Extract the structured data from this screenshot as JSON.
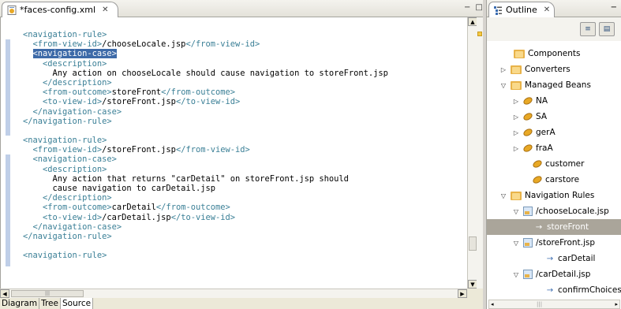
{
  "editor": {
    "tab_label": "*faces-config.xml",
    "tab_close": "✕",
    "view_min": "−",
    "view_max": "□",
    "code_lines": [
      {
        "parts": [
          [
            "tag",
            "<navigation-rule>"
          ]
        ]
      },
      {
        "parts": [
          [
            "tag",
            "  <from-view-id>"
          ],
          [
            "txt",
            "/chooseLocale.jsp"
          ],
          [
            "tag",
            "</from-view-id>"
          ]
        ]
      },
      {
        "parts": [
          [
            "tag",
            "  "
          ],
          [
            "sel",
            "<navigation-case>"
          ]
        ]
      },
      {
        "parts": [
          [
            "tag",
            "    <description>"
          ]
        ]
      },
      {
        "parts": [
          [
            "txt",
            "      Any action on chooseLocale should cause navigation to storeFront.jsp"
          ]
        ]
      },
      {
        "parts": [
          [
            "tag",
            "    </description>"
          ]
        ]
      },
      {
        "parts": [
          [
            "tag",
            "    <from-outcome>"
          ],
          [
            "txt",
            "storeFront"
          ],
          [
            "tag",
            "</from-outcome>"
          ]
        ]
      },
      {
        "parts": [
          [
            "tag",
            "    <to-view-id>"
          ],
          [
            "txt",
            "/storeFront.jsp"
          ],
          [
            "tag",
            "</to-view-id>"
          ]
        ]
      },
      {
        "parts": [
          [
            "tag",
            "  </navigation-case>"
          ]
        ]
      },
      {
        "parts": [
          [
            "tag",
            "</navigation-rule>"
          ]
        ]
      },
      {
        "parts": [
          [
            "txt",
            ""
          ]
        ]
      },
      {
        "parts": [
          [
            "tag",
            "<navigation-rule>"
          ]
        ]
      },
      {
        "parts": [
          [
            "tag",
            "  <from-view-id>"
          ],
          [
            "txt",
            "/storeFront.jsp"
          ],
          [
            "tag",
            "</from-view-id>"
          ]
        ]
      },
      {
        "parts": [
          [
            "tag",
            "  <navigation-case>"
          ]
        ]
      },
      {
        "parts": [
          [
            "tag",
            "    <description>"
          ]
        ]
      },
      {
        "parts": [
          [
            "txt",
            "      Any action that returns \"carDetail\" on storeFront.jsp should"
          ]
        ]
      },
      {
        "parts": [
          [
            "txt",
            "      cause navigation to carDetail.jsp"
          ]
        ]
      },
      {
        "parts": [
          [
            "tag",
            "    </description>"
          ]
        ]
      },
      {
        "parts": [
          [
            "tag",
            "    <from-outcome>"
          ],
          [
            "txt",
            "carDetail"
          ],
          [
            "tag",
            "</from-outcome>"
          ]
        ]
      },
      {
        "parts": [
          [
            "tag",
            "    <to-view-id>"
          ],
          [
            "txt",
            "/carDetail.jsp"
          ],
          [
            "tag",
            "</to-view-id>"
          ]
        ]
      },
      {
        "parts": [
          [
            "tag",
            "  </navigation-case>"
          ]
        ]
      },
      {
        "parts": [
          [
            "tag",
            "</navigation-rule>"
          ]
        ]
      },
      {
        "parts": [
          [
            "txt",
            ""
          ]
        ]
      },
      {
        "parts": [
          [
            "tag",
            "<navigation-rule>"
          ]
        ]
      }
    ],
    "hscroll_thumb": "|||",
    "bottom_tabs": [
      "Diagram",
      "Tree",
      "Source"
    ],
    "active_bottom_tab": "Source"
  },
  "outline": {
    "tab_label": "Outline",
    "tab_close": "✕",
    "minimize": "−",
    "toolbar_buttons": [
      "≡",
      "▤"
    ],
    "tree": [
      {
        "label": "Components",
        "icon": "folder-icon",
        "twisty": ""
      },
      {
        "label": "Converters",
        "icon": "folder-icon",
        "twisty": "▷"
      },
      {
        "label": "Managed Beans",
        "icon": "folder-icon",
        "twisty": "▽"
      },
      {
        "label": "NA",
        "icon": "bean-icon",
        "twisty": "▷"
      },
      {
        "label": "SA",
        "icon": "bean-icon",
        "twisty": "▷"
      },
      {
        "label": "gerA",
        "icon": "bean-icon",
        "twisty": "▷"
      },
      {
        "label": "fraA",
        "icon": "bean-icon",
        "twisty": "▷"
      },
      {
        "label": "customer",
        "icon": "bean-icon",
        "twisty": ""
      },
      {
        "label": "carstore",
        "icon": "bean-icon",
        "twisty": ""
      },
      {
        "label": "Navigation Rules",
        "icon": "folder-icon",
        "twisty": "▽"
      },
      {
        "label": "/chooseLocale.jsp",
        "icon": "page-icon",
        "twisty": "▽"
      },
      {
        "label": "storeFront",
        "icon": "arrow-icon",
        "twisty": "",
        "selected": true
      },
      {
        "label": "/storeFront.jsp",
        "icon": "page-icon",
        "twisty": "▽"
      },
      {
        "label": "carDetail",
        "icon": "arrow-icon",
        "twisty": ""
      },
      {
        "label": "/carDetail.jsp",
        "icon": "page-icon",
        "twisty": "▽"
      },
      {
        "label": "confirmChoices",
        "icon": "arrow-icon",
        "twisty": ""
      }
    ],
    "hscroll_left": "◂",
    "hscroll_right": "▸",
    "hscroll_thumb": "|||"
  }
}
